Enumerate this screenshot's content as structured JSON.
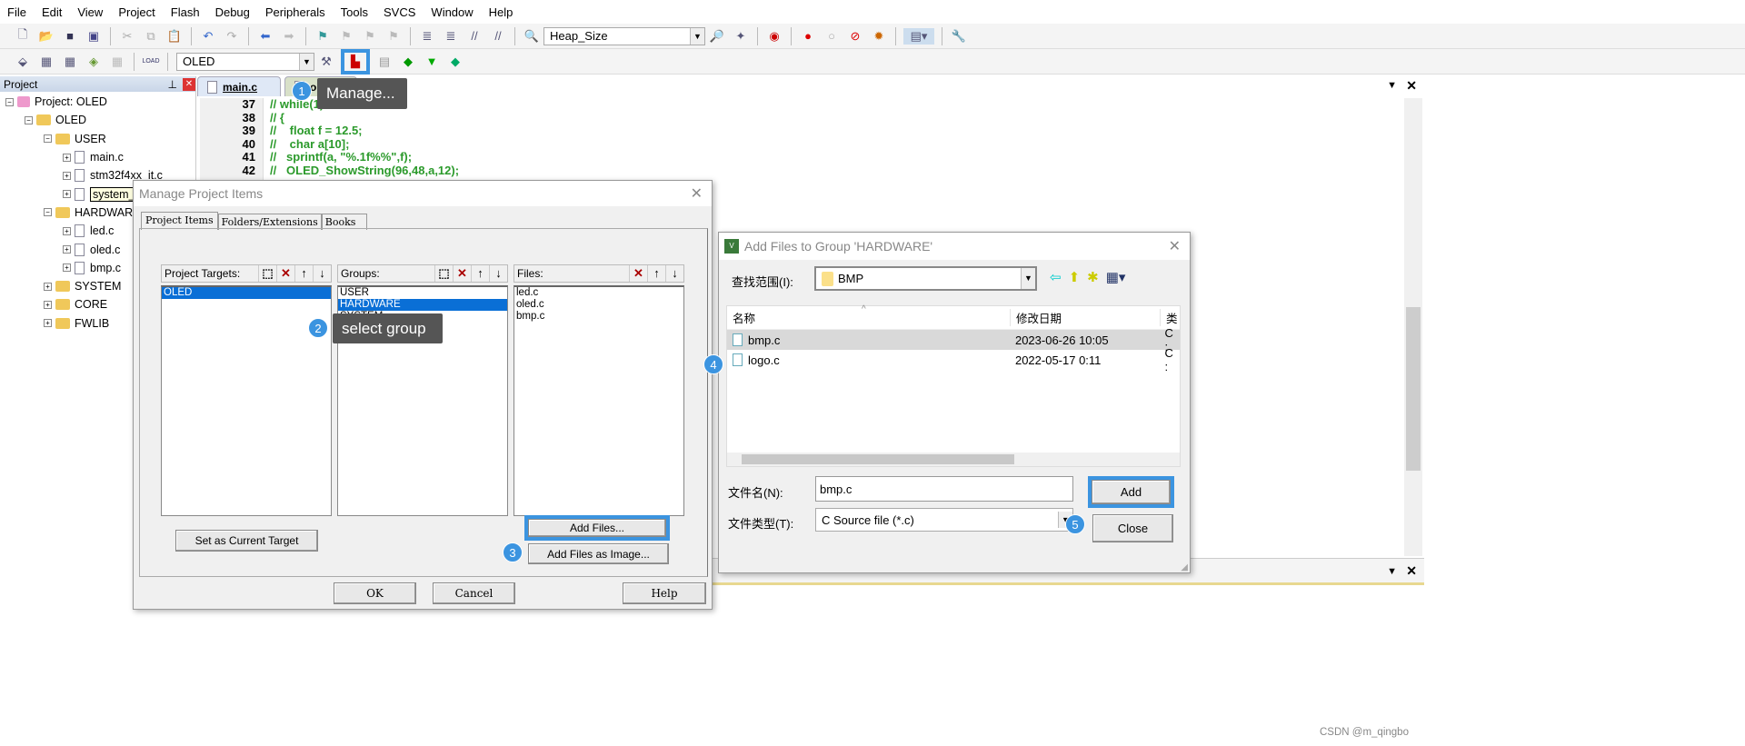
{
  "menu": [
    "File",
    "Edit",
    "View",
    "Project",
    "Flash",
    "Debug",
    "Peripherals",
    "Tools",
    "SVCS",
    "Window",
    "Help"
  ],
  "toolbar": {
    "find_combo": "Heap_Size",
    "target_combo": "OLED",
    "load_label": "LOAD"
  },
  "project_panel": {
    "title": "Project",
    "tree": [
      {
        "label": "Project: OLED",
        "level": 0,
        "type": "project"
      },
      {
        "label": "OLED",
        "level": 1,
        "type": "folder"
      },
      {
        "label": "USER",
        "level": 2,
        "type": "folder"
      },
      {
        "label": "main.c",
        "level": 3,
        "type": "file"
      },
      {
        "label": "stm32f4xx_it.c",
        "level": 3,
        "type": "file"
      },
      {
        "label": "system_stm",
        "level": 3,
        "type": "file"
      },
      {
        "label": "HARDWARE",
        "level": 2,
        "type": "folder"
      },
      {
        "label": "led.c",
        "level": 3,
        "type": "file"
      },
      {
        "label": "oled.c",
        "level": 3,
        "type": "file"
      },
      {
        "label": "bmp.c",
        "level": 3,
        "type": "file"
      },
      {
        "label": "SYSTEM",
        "level": 2,
        "type": "folder"
      },
      {
        "label": "CORE",
        "level": 2,
        "type": "folder"
      },
      {
        "label": "FWLIB",
        "level": 2,
        "type": "folder"
      }
    ]
  },
  "editor": {
    "tabs": [
      "main.c",
      "oled.c"
    ],
    "line_numbers": [
      "37",
      "38",
      "39",
      "40",
      "41",
      "42"
    ],
    "lines": [
      "// while(1)",
      "// {",
      "//    float f = 12.5;",
      "//    char a[10];",
      "//   sprintf(a, \"%.1f%%\",f);",
      "//   OLED_ShowString(96,48,a,12);"
    ]
  },
  "manage_dialog": {
    "title": "Manage Project Items",
    "tabs": [
      "Project Items",
      "Folders/Extensions",
      "Books"
    ],
    "targets_label": "Project Targets:",
    "targets": [
      "OLED"
    ],
    "groups_label": "Groups:",
    "groups": [
      "USER",
      "HARDWARE",
      "SYSTEM",
      "FWLIB"
    ],
    "files_label": "Files:",
    "files": [
      "led.c",
      "oled.c",
      "bmp.c"
    ],
    "set_target": "Set as Current Target",
    "add_files": "Add Files...",
    "add_image": "Add Files as Image...",
    "ok": "OK",
    "cancel": "Cancel",
    "help": "Help"
  },
  "add_dialog": {
    "title": "Add Files to Group 'HARDWARE'",
    "lookin_label": "查找范围(I):",
    "lookin_value": "BMP",
    "columns": [
      "名称",
      "修改日期",
      "类"
    ],
    "files": [
      {
        "name": "bmp.c",
        "date": "2023-06-26 10:05",
        "type": "C :"
      },
      {
        "name": "logo.c",
        "date": "2022-05-17 0:11",
        "type": "C :"
      }
    ],
    "filename_label": "文件名(N):",
    "filename_value": "bmp.c",
    "filetype_label": "文件类型(T):",
    "filetype_value": "C Source file (*.c)",
    "add": "Add",
    "close": "Close"
  },
  "annotations": {
    "b1": "1",
    "b2": "2",
    "b3": "3",
    "b4": "4",
    "b5": "5",
    "tip1": "Manage...",
    "tip2": "select group"
  },
  "watermark": "CSDN @m_qingbo",
  "colors": {
    "highlight": "#3b94e0",
    "selection": "#0a6fd6",
    "code_comment": "#2b9a2b"
  }
}
